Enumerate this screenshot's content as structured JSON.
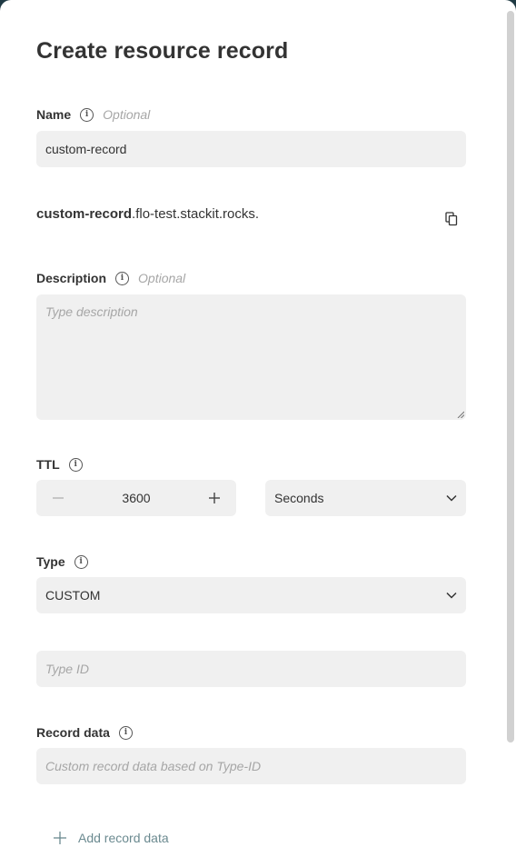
{
  "form": {
    "title": "Create resource record",
    "name": {
      "label": "Name",
      "optional": "Optional",
      "value": "custom-record"
    },
    "fqdn": {
      "record": "custom-record",
      "zone": ".flo-test.stackit.rocks."
    },
    "description": {
      "label": "Description",
      "optional": "Optional",
      "placeholder": "Type description"
    },
    "ttl": {
      "label": "TTL",
      "value": "3600",
      "unit": "Seconds"
    },
    "type": {
      "label": "Type",
      "value": "CUSTOM"
    },
    "type_id": {
      "placeholder": "Type ID"
    },
    "record_data": {
      "label": "Record data",
      "placeholder": "Custom record data based on Type-ID"
    },
    "add_record_data_label": "Add record data"
  },
  "icons": {
    "info": "info-icon",
    "copy": "copy-icon",
    "minus": "minus-icon",
    "plus": "plus-icon",
    "chevron": "chevron-down-icon"
  },
  "colors": {
    "field_background": "#f0f0f0",
    "placeholder": "#a6a6a6",
    "accent_muted": "#6b8a90"
  }
}
